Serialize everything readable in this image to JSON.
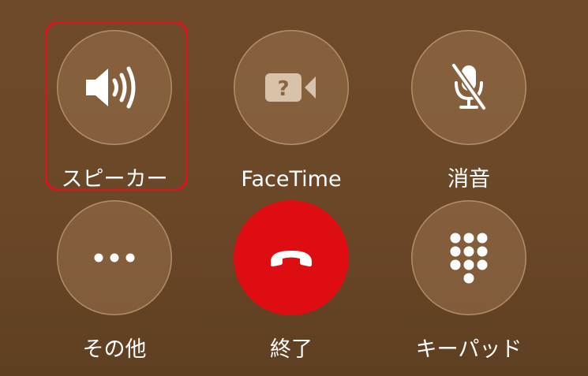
{
  "controls": {
    "speaker": {
      "label": "スピーカー",
      "icon": "speaker-icon"
    },
    "facetime": {
      "label": "FaceTime",
      "icon": "facetime-video-icon",
      "glyph": "?"
    },
    "mute": {
      "label": "消音",
      "icon": "mic-slash-icon"
    },
    "more": {
      "label": "その他",
      "icon": "ellipsis-icon"
    },
    "end": {
      "label": "終了",
      "icon": "phone-hangup-icon"
    },
    "keypad": {
      "label": "キーパッド",
      "icon": "keypad-icon"
    }
  },
  "colors": {
    "background": "#6a4727",
    "button_fill": "#9b734e",
    "end_call": "#de0d12",
    "highlight": "#e0121c",
    "icon_light": "#ffffff",
    "icon_dim": "#d8c2a9"
  }
}
